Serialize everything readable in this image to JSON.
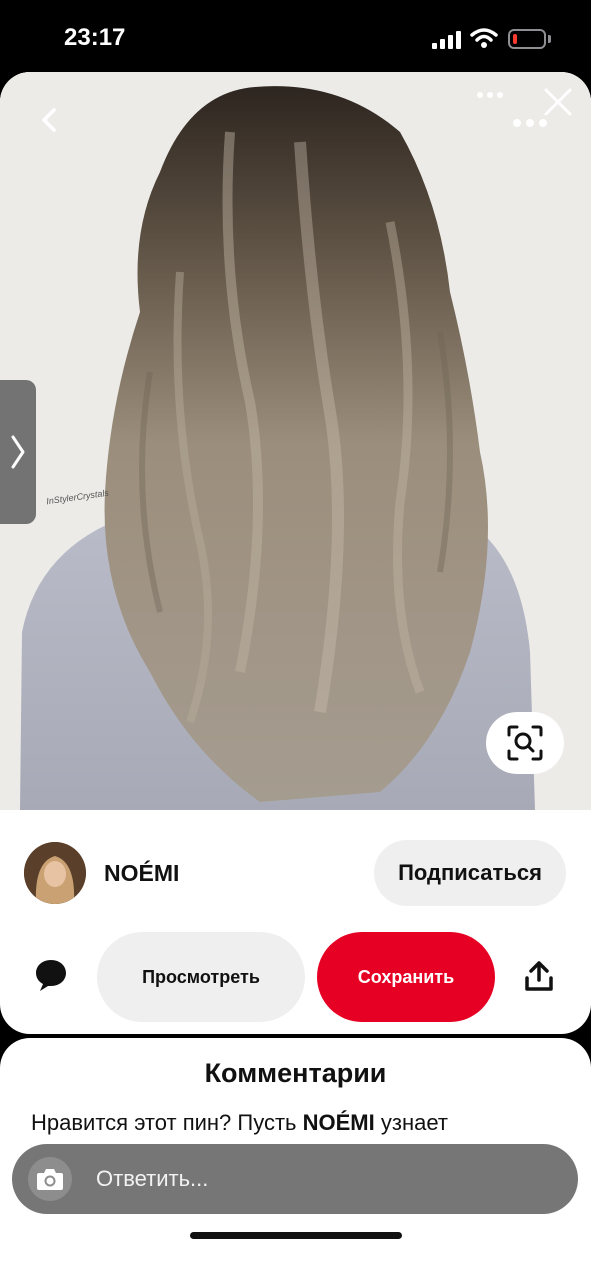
{
  "status_bar": {
    "time": "23:17",
    "battery_percent": 15,
    "battery_color": "#ff3b30"
  },
  "pin": {
    "image_alt": "Long wavy ash-blonde balayage hair, view from behind",
    "watermark": "InStylerCrystals",
    "nav": {
      "back_icon": "chevron-left-icon",
      "more_icon": "ellipsis-icon",
      "close_icon": "close-icon",
      "sidebar_icon": "chevron-right-icon",
      "lens_icon": "visual-search-icon"
    }
  },
  "creator": {
    "name": "NOÉMI",
    "follow_label": "Подписаться"
  },
  "actions": {
    "view_label": "Просмотреть",
    "save_label": "Сохранить",
    "save_color": "#e60023",
    "comment_icon": "speech-bubble-icon",
    "share_icon": "share-icon"
  },
  "comments": {
    "title": "Комментарии",
    "prompt_prefix": "Нравится этот пин? Пусть ",
    "prompt_name": "NOÉMI",
    "prompt_suffix": " узнает",
    "reply_placeholder": "Ответить...",
    "camera_icon": "camera-icon"
  }
}
